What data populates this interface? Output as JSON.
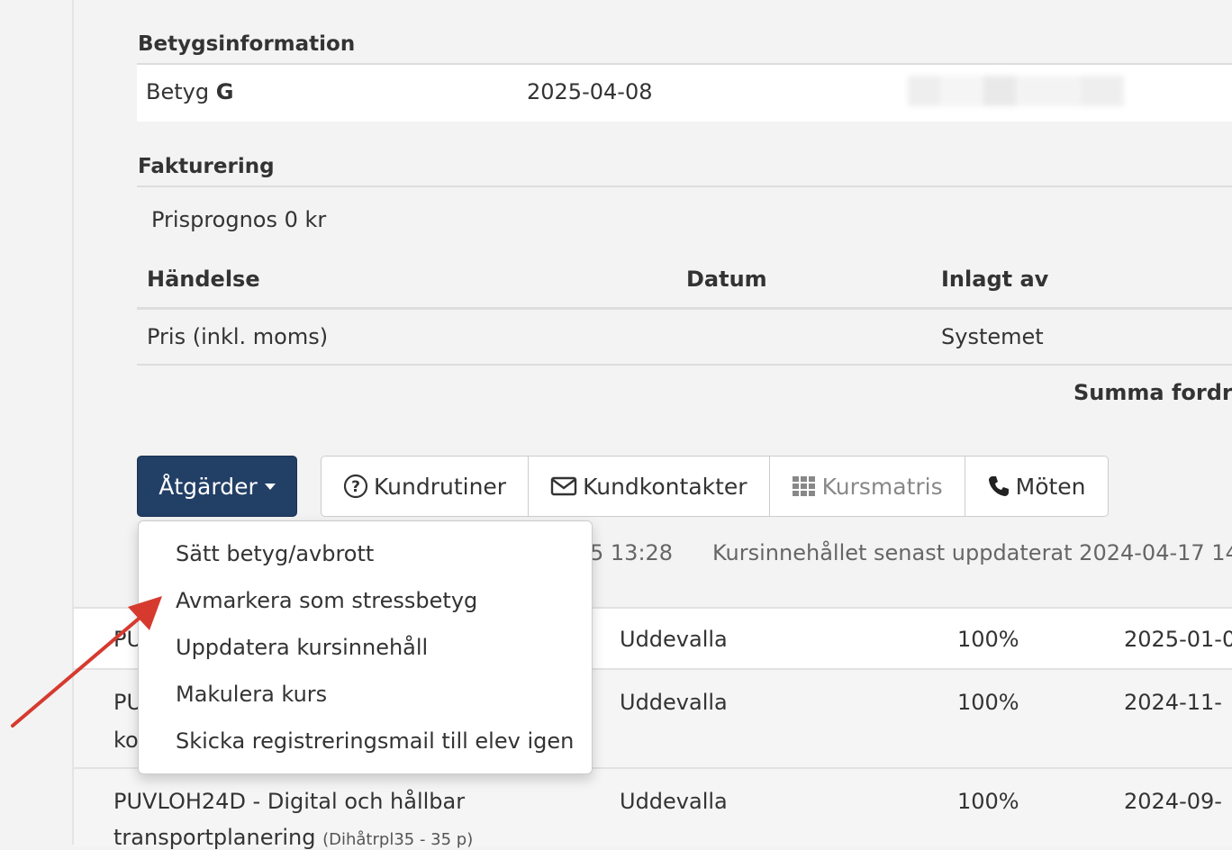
{
  "betygsinfo": {
    "heading": "Betygsinformation",
    "grade_label": "Betyg",
    "grade_value": "G",
    "grade_date": "2025-04-08"
  },
  "fakturering": {
    "heading": "Fakturering",
    "prisprognos": "Prisprognos 0 kr",
    "columns": [
      "Händelse",
      "Datum",
      "Inlagt av"
    ],
    "rows": [
      {
        "handelse": "Pris (inkl. moms)",
        "datum": "",
        "inlagt_av": "Systemet"
      }
    ],
    "summa": "Summa fordran"
  },
  "toolbar": {
    "actions_label": "Åtgärder",
    "kundrutiner": "Kundrutiner",
    "kundkontakter": "Kundkontakter",
    "kursmatris": "Kursmatris",
    "moten": "Möten"
  },
  "meta": {
    "time_fragment": "5 13:28",
    "updated": "Kursinnehållet senast uppdaterat 2024-04-17 14"
  },
  "dropdown": {
    "items": [
      "Sätt betyg/avbrott",
      "Avmarkera som stressbetyg",
      "Uppdatera kursinnehåll",
      "Makulera kurs",
      "Skicka registreringsmail till elev igen"
    ]
  },
  "courses": [
    {
      "name": "PU",
      "name2": "",
      "ort": "Uddevalla",
      "pct": "100%",
      "date": "2025-01-0"
    },
    {
      "name": "PU",
      "name2": "ko",
      "ort": "Uddevalla",
      "pct": "100%",
      "date": "2024-11-"
    },
    {
      "name": "PUVLOH24D - Digital och hållbar",
      "name2": "transportplanering",
      "name2_small": "(Dihåtrpl35 - 35 p)",
      "ort": "Uddevalla",
      "pct": "100%",
      "date": "2024-09-"
    }
  ],
  "colors": {
    "primary": "#223f66",
    "link": "#3371b8",
    "annotation_arrow": "#d63a2f"
  },
  "icons": {
    "kundrutiner": "question-circle-icon",
    "kundkontakter": "envelope-icon",
    "kursmatris": "grid-icon",
    "moten": "phone-icon"
  }
}
